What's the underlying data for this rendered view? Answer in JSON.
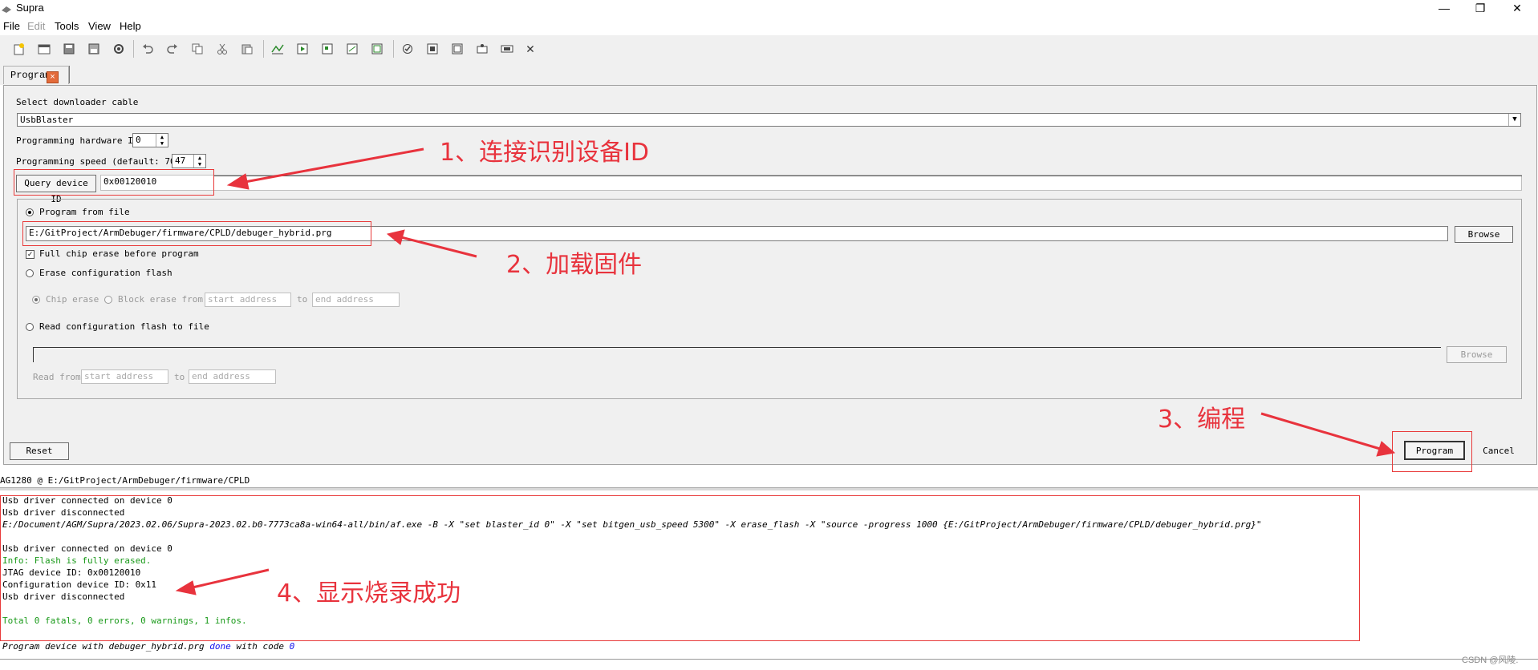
{
  "window": {
    "title": "Supra",
    "minimize": "—",
    "restore": "❐",
    "close": "✕"
  },
  "menu": [
    "File",
    "Edit",
    "Tools",
    "View",
    "Help"
  ],
  "tab": {
    "label": "Program",
    "close": "×"
  },
  "cable": {
    "label": "Select downloader cable",
    "value": "UsbBlaster"
  },
  "hw_id": {
    "label": "Programming hardware ID",
    "value": "0"
  },
  "speed": {
    "label": "Programming speed (default: 70)",
    "value": "47"
  },
  "query": {
    "button": "Query device ID",
    "value": "0x00120010"
  },
  "program_from_file": {
    "label": "Program from file",
    "path": "E:/GitProject/ArmDebuger/firmware/CPLD/debuger_hybrid.prg",
    "browse": "Browse"
  },
  "full_chip_erase": {
    "label": "Full chip erase before program",
    "checked": true
  },
  "erase_flash": {
    "label": "Erase configuration flash",
    "chip_erase": "Chip erase",
    "block_erase": "Block erase from",
    "start_ph": "start address",
    "to": "to",
    "end_ph": "end address"
  },
  "read_flash": {
    "label": "Read configuration flash to file",
    "browse": "Browse",
    "read_from": "Read from",
    "start_ph": "start address",
    "to": "to",
    "end_ph": "end address"
  },
  "buttons": {
    "reset": "Reset",
    "program": "Program",
    "cancel": "Cancel"
  },
  "status_path": "AG1280 @ E:/GitProject/ArmDebuger/firmware/CPLD",
  "log": {
    "l1": "Usb driver connected on device 0",
    "l2": "Usb driver disconnected",
    "l3": "E:/Document/AGM/Supra/2023.02.06/Supra-2023.02.b0-7773ca8a-win64-all/bin/af.exe -B -X \"set blaster_id 0\" -X \"set bitgen_usb_speed 5300\" -X erase_flash -X \"source -progress 1000 {E:/GitProject/ArmDebuger/firmware/CPLD/debuger_hybrid.prg}\"",
    "l4": "Usb driver connected on device 0",
    "l5": "Info: Flash is fully erased.",
    "l6": "JTAG device ID: 0x00120010",
    "l7": "Configuration device ID: 0x11",
    "l8": "Usb driver disconnected",
    "l9": "Total 0 fatals, 0 errors, 0 warnings, 1 infos.",
    "done_a": "Program device with debuger_hybrid.prg",
    "done_b": "done",
    "done_c": "with code",
    "done_d": "0"
  },
  "annotations": {
    "a1": "1、连接识别设备ID",
    "a2": "2、加载固件",
    "a3": "3、编程",
    "a4": "4、显示烧录成功"
  },
  "watermark": "CSDN @风陵.",
  "colors": {
    "annotation": "#e8333d",
    "info_green": "#1a9a1a",
    "done_blue": "#1010ee"
  }
}
